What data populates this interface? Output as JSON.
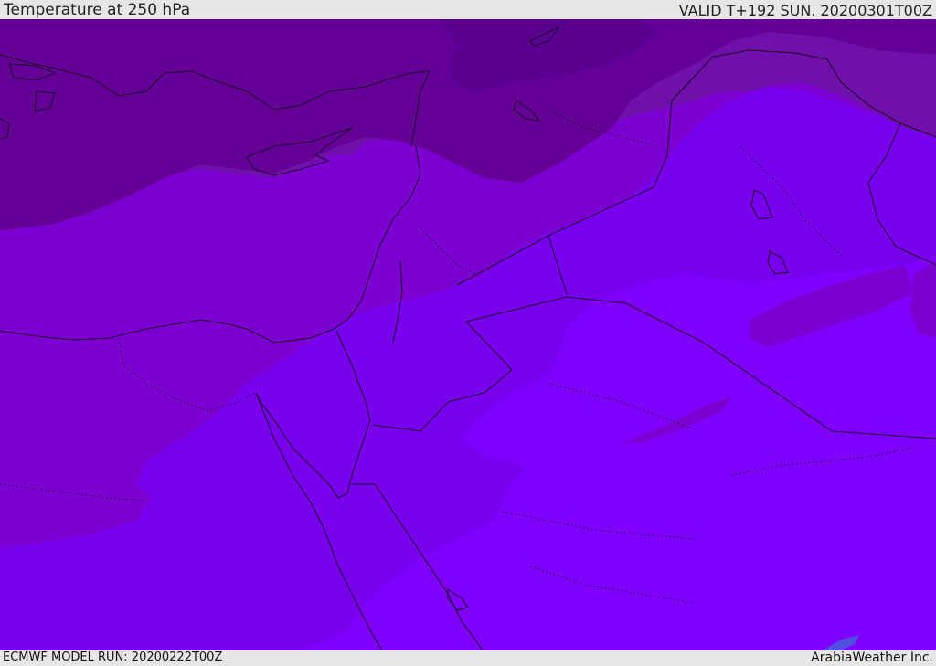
{
  "header": {
    "title": "Temperature at 250 hPa",
    "valid": "VALID T+192 SUN. 20200301T00Z"
  },
  "footer": {
    "model_run": "ECMWF MODEL RUN: 20200222T00Z",
    "credit": "ArabiaWeather Inc."
  },
  "colors": {
    "band_darkest": "#5a0090",
    "band_dark": "#640096",
    "band_mid": "#7010ab",
    "band_purple": "#7c00d2",
    "band_violet": "#7800ee",
    "band_bright": "#7f00ff",
    "band_hint": "#5050e0",
    "coastline": "#1a0a28"
  }
}
